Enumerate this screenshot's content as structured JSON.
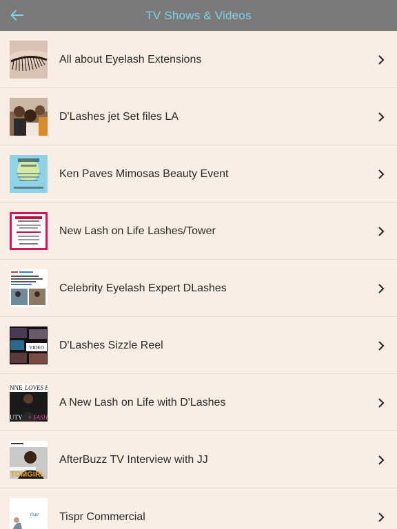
{
  "header": {
    "title": "TV Shows & Videos",
    "back_icon": "arrow-left-icon",
    "background_color": "#7a7a7a",
    "title_color": "#7fd0e8"
  },
  "list": {
    "background_color": "#faeee4",
    "chevron_icon": "chevron-right-icon",
    "items": [
      {
        "label": "All about Eyelash Extensions",
        "thumb": "eyelash-closeup"
      },
      {
        "label": "D'Lashes jet Set files LA",
        "thumb": "group-selfie"
      },
      {
        "label": "Ken Paves Mimosas Beauty Event",
        "thumb": "mimosa-flyer"
      },
      {
        "label": "New Lash on Life Lashes/Tower",
        "thumb": "event-flyer"
      },
      {
        "label": "Celebrity Eyelash Expert DLashes",
        "thumb": "article-page"
      },
      {
        "label": "D'Lashes Sizzle Reel",
        "thumb": "video-collage"
      },
      {
        "label": "A New Lash on Life with D'Lashes",
        "thumb": "magazine-cover"
      },
      {
        "label": "AfterBuzz TV Interview with JJ",
        "thumb": "tv-interview"
      },
      {
        "label": "Tispr Commercial",
        "thumb": "tispr-ad"
      }
    ]
  }
}
